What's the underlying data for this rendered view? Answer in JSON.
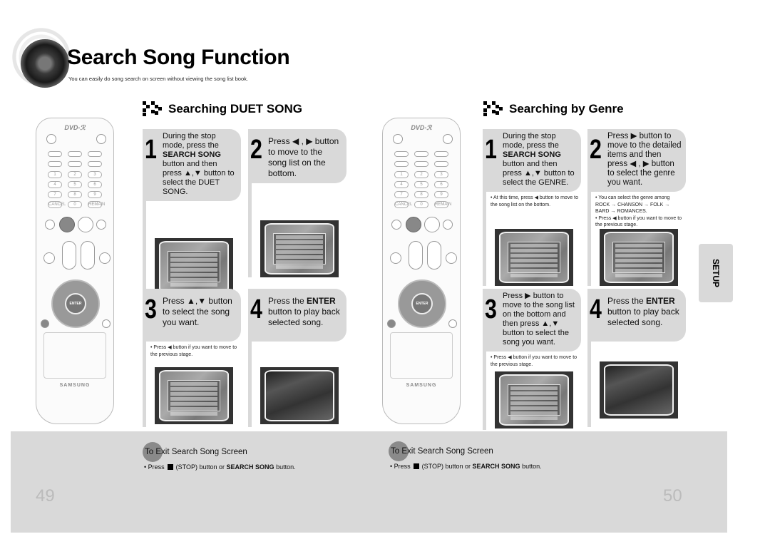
{
  "header": {
    "title": "Search Song Function",
    "subtitle": "You can easily do song search on screen without viewing the song list book."
  },
  "sections": [
    {
      "title": "Searching DUET SONG",
      "steps": [
        {
          "num": "1",
          "text_parts": [
            "During the stop mode, press the ",
            "SEARCH SONG",
            " button and then press ▲,▼ button to select the DUET SONG."
          ],
          "note": ""
        },
        {
          "num": "2",
          "text_parts": [
            "Press ◀ , ▶ button to move to the song list on the bottom.",
            "",
            ""
          ],
          "note": ""
        },
        {
          "num": "3",
          "text_parts": [
            "Press ▲,▼ button to select the song you want.",
            "",
            ""
          ],
          "note": "• Press ◀ button if you want to move to the previous stage."
        },
        {
          "num": "4",
          "text_parts": [
            "Press the ",
            "ENTER",
            " button to play back selected song."
          ],
          "note": ""
        }
      ]
    },
    {
      "title": "Searching by Genre",
      "steps": [
        {
          "num": "1",
          "text_parts": [
            "During the stop mode, press the ",
            "SEARCH SONG",
            " button and then press ▲,▼ button to select the GENRE."
          ],
          "note": "• At this time, press ◀ button to move to the song list on the bottom."
        },
        {
          "num": "2",
          "text_parts": [
            "Press ▶ button to move to the detailed items and then press ◀ , ▶ button to select the genre you want.",
            "",
            ""
          ],
          "note": "• You can select the genre among ROCK → CHANSON → FOLK → BARD → ROMANCES.",
          "note2": "• Press ◀ button if you want to move to the previous stage."
        },
        {
          "num": "3",
          "text_parts": [
            "Press ▶ button to move to the song list on the bottom and then press ▲,▼ button to select the song you want.",
            "",
            ""
          ],
          "note": "• Press ◀ button if you want to move to the previous stage."
        },
        {
          "num": "4",
          "text_parts": [
            "Press the ",
            "ENTER",
            " button to play back selected song."
          ],
          "note": ""
        }
      ]
    }
  ],
  "remote": {
    "logo": "DVD-ℛ",
    "brand": "SAMSUNG",
    "enter_label": "ENTER",
    "number_keys": [
      "1",
      "2",
      "3",
      "4",
      "5",
      "6",
      "7",
      "8",
      "9",
      "CANCEL",
      "0",
      "REMAIN"
    ]
  },
  "side_tab": {
    "label": "SETUP"
  },
  "footer": {
    "exit_title": "To Exit Search Song Screen",
    "exit_note_pre": "• Press",
    "exit_note_mid": "(STOP) button or ",
    "exit_note_bold": "SEARCH SONG",
    "exit_note_post": " button."
  },
  "pages": {
    "left": "49",
    "right": "50"
  }
}
